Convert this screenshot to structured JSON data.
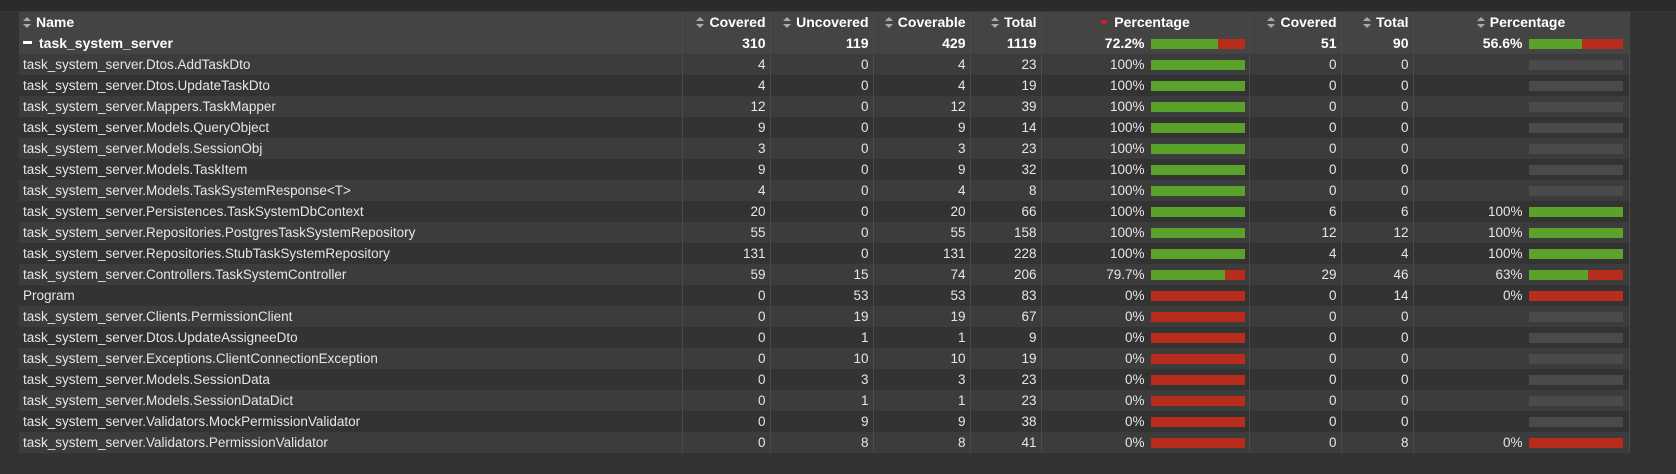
{
  "headers": {
    "name": "Name",
    "covered": "Covered",
    "uncovered": "Uncovered",
    "coverable": "Coverable",
    "total": "Total",
    "percentage": "Percentage",
    "branch_covered": "Covered",
    "branch_total": "Total",
    "branch_percentage": "Percentage"
  },
  "summary": {
    "name": "task_system_server",
    "covered": "310",
    "uncovered": "119",
    "coverable": "429",
    "total": "1119",
    "percentage": "72.2%",
    "line_fraction": 0.722,
    "branch_covered": "51",
    "branch_total": "90",
    "branch_percentage": "56.6%",
    "branch_fraction": 0.566
  },
  "rows": [
    {
      "name": "task_system_server.Dtos.AddTaskDto",
      "covered": "4",
      "uncovered": "0",
      "coverable": "4",
      "total": "23",
      "percentage": "100%",
      "line_fraction": 1.0,
      "branch_covered": "0",
      "branch_total": "0",
      "branch_percentage": "",
      "branch_fraction": null
    },
    {
      "name": "task_system_server.Dtos.UpdateTaskDto",
      "covered": "4",
      "uncovered": "0",
      "coverable": "4",
      "total": "19",
      "percentage": "100%",
      "line_fraction": 1.0,
      "branch_covered": "0",
      "branch_total": "0",
      "branch_percentage": "",
      "branch_fraction": null
    },
    {
      "name": "task_system_server.Mappers.TaskMapper",
      "covered": "12",
      "uncovered": "0",
      "coverable": "12",
      "total": "39",
      "percentage": "100%",
      "line_fraction": 1.0,
      "branch_covered": "0",
      "branch_total": "0",
      "branch_percentage": "",
      "branch_fraction": null
    },
    {
      "name": "task_system_server.Models.QueryObject",
      "covered": "9",
      "uncovered": "0",
      "coverable": "9",
      "total": "14",
      "percentage": "100%",
      "line_fraction": 1.0,
      "branch_covered": "0",
      "branch_total": "0",
      "branch_percentage": "",
      "branch_fraction": null
    },
    {
      "name": "task_system_server.Models.SessionObj",
      "covered": "3",
      "uncovered": "0",
      "coverable": "3",
      "total": "23",
      "percentage": "100%",
      "line_fraction": 1.0,
      "branch_covered": "0",
      "branch_total": "0",
      "branch_percentage": "",
      "branch_fraction": null
    },
    {
      "name": "task_system_server.Models.TaskItem",
      "covered": "9",
      "uncovered": "0",
      "coverable": "9",
      "total": "32",
      "percentage": "100%",
      "line_fraction": 1.0,
      "branch_covered": "0",
      "branch_total": "0",
      "branch_percentage": "",
      "branch_fraction": null
    },
    {
      "name": "task_system_server.Models.TaskSystemResponse<T>",
      "covered": "4",
      "uncovered": "0",
      "coverable": "4",
      "total": "8",
      "percentage": "100%",
      "line_fraction": 1.0,
      "branch_covered": "0",
      "branch_total": "0",
      "branch_percentage": "",
      "branch_fraction": null
    },
    {
      "name": "task_system_server.Persistences.TaskSystemDbContext",
      "covered": "20",
      "uncovered": "0",
      "coverable": "20",
      "total": "66",
      "percentage": "100%",
      "line_fraction": 1.0,
      "branch_covered": "6",
      "branch_total": "6",
      "branch_percentage": "100%",
      "branch_fraction": 1.0
    },
    {
      "name": "task_system_server.Repositories.PostgresTaskSystemRepository",
      "covered": "55",
      "uncovered": "0",
      "coverable": "55",
      "total": "158",
      "percentage": "100%",
      "line_fraction": 1.0,
      "branch_covered": "12",
      "branch_total": "12",
      "branch_percentage": "100%",
      "branch_fraction": 1.0
    },
    {
      "name": "task_system_server.Repositories.StubTaskSystemRepository",
      "covered": "131",
      "uncovered": "0",
      "coverable": "131",
      "total": "228",
      "percentage": "100%",
      "line_fraction": 1.0,
      "branch_covered": "4",
      "branch_total": "4",
      "branch_percentage": "100%",
      "branch_fraction": 1.0
    },
    {
      "name": "task_system_server.Controllers.TaskSystemController",
      "covered": "59",
      "uncovered": "15",
      "coverable": "74",
      "total": "206",
      "percentage": "79.7%",
      "line_fraction": 0.797,
      "branch_covered": "29",
      "branch_total": "46",
      "branch_percentage": "63%",
      "branch_fraction": 0.63
    },
    {
      "name": "Program",
      "covered": "0",
      "uncovered": "53",
      "coverable": "53",
      "total": "83",
      "percentage": "0%",
      "line_fraction": 0.0,
      "branch_covered": "0",
      "branch_total": "14",
      "branch_percentage": "0%",
      "branch_fraction": 0.0
    },
    {
      "name": "task_system_server.Clients.PermissionClient",
      "covered": "0",
      "uncovered": "19",
      "coverable": "19",
      "total": "67",
      "percentage": "0%",
      "line_fraction": 0.0,
      "branch_covered": "0",
      "branch_total": "0",
      "branch_percentage": "",
      "branch_fraction": null
    },
    {
      "name": "task_system_server.Dtos.UpdateAssigneeDto",
      "covered": "0",
      "uncovered": "1",
      "coverable": "1",
      "total": "9",
      "percentage": "0%",
      "line_fraction": 0.0,
      "branch_covered": "0",
      "branch_total": "0",
      "branch_percentage": "",
      "branch_fraction": null
    },
    {
      "name": "task_system_server.Exceptions.ClientConnectionException",
      "covered": "0",
      "uncovered": "10",
      "coverable": "10",
      "total": "19",
      "percentage": "0%",
      "line_fraction": 0.0,
      "branch_covered": "0",
      "branch_total": "0",
      "branch_percentage": "",
      "branch_fraction": null
    },
    {
      "name": "task_system_server.Models.SessionData",
      "covered": "0",
      "uncovered": "3",
      "coverable": "3",
      "total": "23",
      "percentage": "0%",
      "line_fraction": 0.0,
      "branch_covered": "0",
      "branch_total": "0",
      "branch_percentage": "",
      "branch_fraction": null
    },
    {
      "name": "task_system_server.Models.SessionDataDict",
      "covered": "0",
      "uncovered": "1",
      "coverable": "1",
      "total": "23",
      "percentage": "0%",
      "line_fraction": 0.0,
      "branch_covered": "0",
      "branch_total": "0",
      "branch_percentage": "",
      "branch_fraction": null
    },
    {
      "name": "task_system_server.Validators.MockPermissionValidator",
      "covered": "0",
      "uncovered": "9",
      "coverable": "9",
      "total": "38",
      "percentage": "0%",
      "line_fraction": 0.0,
      "branch_covered": "0",
      "branch_total": "0",
      "branch_percentage": "",
      "branch_fraction": null
    },
    {
      "name": "task_system_server.Validators.PermissionValidator",
      "covered": "0",
      "uncovered": "8",
      "coverable": "8",
      "total": "41",
      "percentage": "0%",
      "line_fraction": 0.0,
      "branch_covered": "0",
      "branch_total": "8",
      "branch_percentage": "0%",
      "branch_fraction": 0.0
    }
  ],
  "icons": {
    "sort": "sort-icon",
    "sort_active": "sort-descending-icon",
    "collapse": "collapse-minus-icon"
  },
  "colors": {
    "covered_bar": "#5aa22a",
    "uncovered_bar": "#b82c1c",
    "empty_bar": "#4a4a4a",
    "sort_active": "#c1272d"
  }
}
